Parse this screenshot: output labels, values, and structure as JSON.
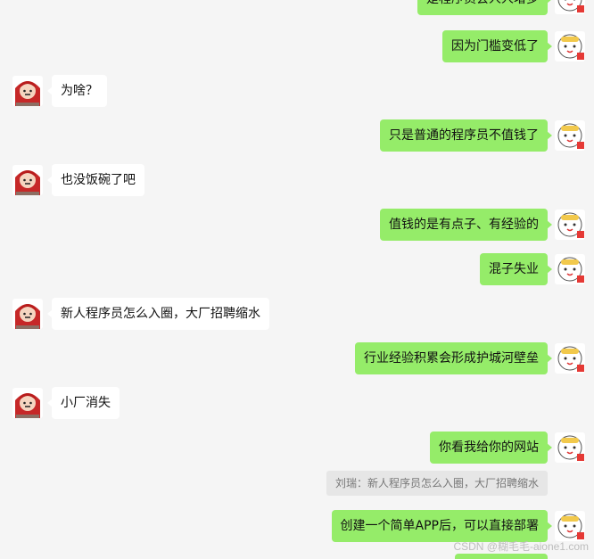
{
  "messages": [
    {
      "id": "m1",
      "side": "me",
      "text": "是程序员会人人增多"
    },
    {
      "id": "m2",
      "side": "me",
      "text": "因为门槛变低了"
    },
    {
      "id": "m3",
      "side": "them",
      "text": "为啥？"
    },
    {
      "id": "m4",
      "side": "me",
      "text": "只是普通的程序员不值钱了"
    },
    {
      "id": "m5",
      "side": "them",
      "text": "也没饭碗了吧"
    },
    {
      "id": "m6",
      "side": "me",
      "text": "值钱的是有点子、有经验的"
    },
    {
      "id": "m7",
      "side": "me",
      "text": "混子失业"
    },
    {
      "id": "m8",
      "side": "them",
      "text": "新人程序员怎么入圈，大厂招聘缩水"
    },
    {
      "id": "m9",
      "side": "me",
      "text": "行业经验积累会形成护城河壁垒"
    },
    {
      "id": "m10",
      "side": "them",
      "text": "小厂消失"
    },
    {
      "id": "m11",
      "side": "me",
      "text": "你看我给你的网站"
    },
    {
      "id": "m12",
      "side": "me",
      "text": "创建一个简单APP后，可以直接部署"
    }
  ],
  "quote": {
    "text": "刘瑞：新人程序员怎么入圈，大厂招聘缩水"
  },
  "watermark": "CSDN @糊毛毛-aione1.com",
  "colors": {
    "me_bubble": "#95ec69",
    "them_bubble": "#ffffff",
    "background": "#f5f5f5"
  }
}
